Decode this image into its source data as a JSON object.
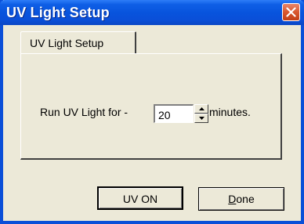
{
  "window": {
    "title": "UV Light Setup"
  },
  "tabs": [
    {
      "label": "UV Light Setup",
      "active": true
    }
  ],
  "form": {
    "run_label": "Run UV Light for -",
    "duration_value": "20",
    "units_label": "minutes."
  },
  "buttons": {
    "uv_on_label": "UV ON",
    "done_first_letter": "D",
    "done_rest": "one"
  },
  "icons": {
    "close": "close-icon",
    "spin_up": "spin-up-icon",
    "spin_down": "spin-down-icon"
  },
  "colors": {
    "title_bar": "#0a4fd8",
    "close_button": "#d8582f",
    "dialog_bg": "#ece9d8"
  }
}
